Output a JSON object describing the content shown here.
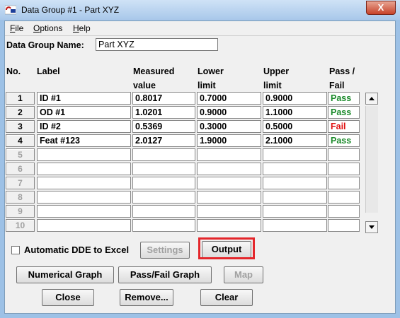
{
  "window": {
    "title": "Data Group #1 - Part XYZ",
    "close_label": "X"
  },
  "menu": [
    {
      "first": "F",
      "rest": "ile"
    },
    {
      "first": "O",
      "rest": "ptions"
    },
    {
      "first": "H",
      "rest": "elp"
    }
  ],
  "group": {
    "label": "Data Group Name:",
    "value": "Part XYZ"
  },
  "headers": {
    "no": "No.",
    "label": "Label",
    "measured_1": "Measured",
    "measured_2": "value",
    "lower_1": "Lower",
    "lower_2": "limit",
    "upper_1": "Upper",
    "upper_2": "limit",
    "pass_1": "Pass /",
    "pass_2": "Fail"
  },
  "rows": [
    {
      "no": "1",
      "label": "ID #1",
      "measured": "0.8017",
      "lower": "0.7000",
      "upper": "0.9000",
      "result": "Pass"
    },
    {
      "no": "2",
      "label": "OD #1",
      "measured": "1.0201",
      "lower": "0.9000",
      "upper": "1.1000",
      "result": "Pass"
    },
    {
      "no": "3",
      "label": "ID #2",
      "measured": "0.5369",
      "lower": "0.3000",
      "upper": "0.5000",
      "result": "Fail"
    },
    {
      "no": "4",
      "label": "Feat #123",
      "measured": "2.0127",
      "lower": "1.9000",
      "upper": "2.1000",
      "result": "Pass"
    },
    {
      "no": "5",
      "label": "",
      "measured": "",
      "lower": "",
      "upper": "",
      "result": ""
    },
    {
      "no": "6",
      "label": "",
      "measured": "",
      "lower": "",
      "upper": "",
      "result": ""
    },
    {
      "no": "7",
      "label": "",
      "measured": "",
      "lower": "",
      "upper": "",
      "result": ""
    },
    {
      "no": "8",
      "label": "",
      "measured": "",
      "lower": "",
      "upper": "",
      "result": ""
    },
    {
      "no": "9",
      "label": "",
      "measured": "",
      "lower": "",
      "upper": "",
      "result": ""
    },
    {
      "no": "10",
      "label": "",
      "measured": "",
      "lower": "",
      "upper": "",
      "result": ""
    }
  ],
  "options": {
    "auto_dde_label": "Automatic DDE to Excel",
    "auto_dde_checked": false
  },
  "buttons": {
    "settings": "Settings",
    "output": "Output",
    "numerical_graph": "Numerical Graph",
    "passfail_graph": "Pass/Fail Graph",
    "map": "Map",
    "close": "Close",
    "remove": "Remove...",
    "clear": "Clear"
  },
  "colors": {
    "pass": "#1a8a2a",
    "fail": "#e01010",
    "highlight": "#e4262b"
  }
}
